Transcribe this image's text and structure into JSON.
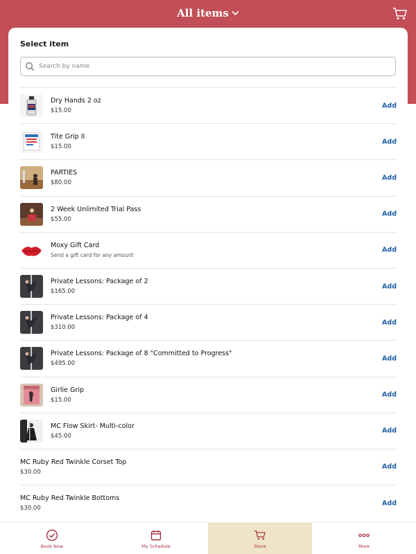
{
  "header": {
    "title": "All items",
    "accent": "#c24e57"
  },
  "sheet": {
    "title": "Select item",
    "search_placeholder": "Search by name"
  },
  "items": [
    {
      "name": "Dry Hands 2 oz",
      "price": "$15.00",
      "add": "Add",
      "thumb": "bottle"
    },
    {
      "name": "Tite Grip II",
      "price": "$15.00",
      "add": "Add",
      "thumb": "label"
    },
    {
      "name": "PARTIES",
      "price": "$80.00",
      "add": "Add",
      "thumb": "room"
    },
    {
      "name": "2 Week Unlimited Trial Pass",
      "price": "$55.00",
      "add": "Add",
      "thumb": "dancer-red"
    },
    {
      "name": "Moxy Gift Card",
      "price": "Send a gift card for any amount",
      "add": "Add",
      "thumb": "lips"
    },
    {
      "name": "Private Lessons: Package of 2",
      "price": "$165.00",
      "add": "Add",
      "thumb": "pole"
    },
    {
      "name": "Private Lessons: Package of 4",
      "price": "$310.00",
      "add": "Add",
      "thumb": "pole"
    },
    {
      "name": "Private Lessons: Package of 8 \"Committed to Progress\"",
      "price": "$495.00",
      "add": "Add",
      "thumb": "pole"
    },
    {
      "name": "Girlie Grip",
      "price": "$15.00",
      "add": "Add",
      "thumb": "pink"
    },
    {
      "name": "MC Flow Skirt- Multi-color",
      "price": "$45.00",
      "add": "Add",
      "thumb": "skirt"
    },
    {
      "name": "MC Ruby Red Twinkle Corset Top",
      "price": "$30.00",
      "add": "Add",
      "thumb": ""
    },
    {
      "name": "MC Ruby Red Twinkle Bottoms",
      "price": "$30.00",
      "add": "Add",
      "thumb": ""
    }
  ],
  "tabbar": {
    "book": "Book Now",
    "schedule": "My Schedule",
    "store": "Store",
    "more": "More"
  },
  "colors": {
    "link": "#1f5fa6",
    "active_tab": "#efe4c6",
    "tab_text": "#a33040"
  }
}
